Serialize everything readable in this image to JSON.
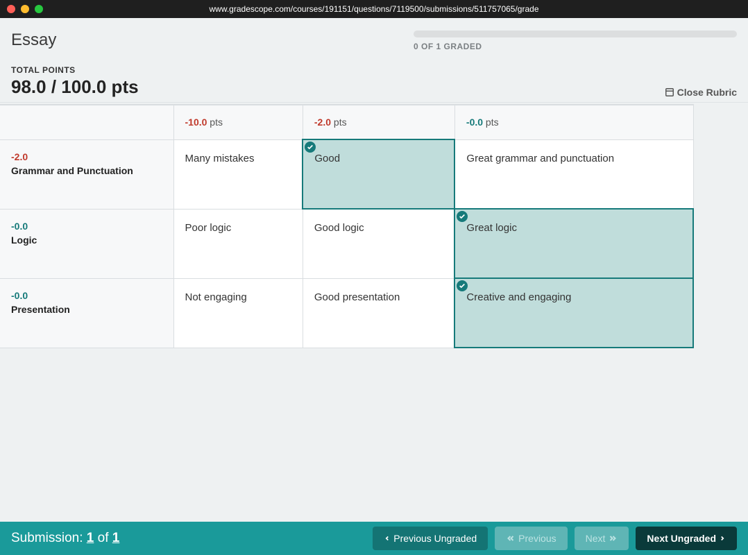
{
  "window": {
    "url": "www.gradescope.com/courses/191151/questions/7119500/submissions/511757065/grade"
  },
  "header": {
    "title": "Essay",
    "progress_text": "0 OF 1 GRADED"
  },
  "points": {
    "label": "TOTAL POINTS",
    "value": "98.0 / 100.0 pts",
    "close_rubric": "Close Rubric"
  },
  "rubric": {
    "col_pts": [
      "-10.0",
      "-2.0",
      "-0.0"
    ],
    "pts_unit": " pts",
    "rows": [
      {
        "points": "-2.0",
        "name": "Grammar and Punctuation",
        "cells": [
          "Many mistakes",
          "Good",
          "Great grammar and punctuation"
        ],
        "selected": 1,
        "points_style": "neg"
      },
      {
        "points": "-0.0",
        "name": "Logic",
        "cells": [
          "Poor logic",
          "Good logic",
          "Great logic"
        ],
        "selected": 2,
        "points_style": "zero"
      },
      {
        "points": "-0.0",
        "name": "Presentation",
        "cells": [
          "Not engaging",
          "Good presentation",
          "Creative and engaging"
        ],
        "selected": 2,
        "points_style": "zero"
      }
    ]
  },
  "footer": {
    "submission_prefix": "Submission: ",
    "current": "1",
    "of": " of ",
    "total": "1",
    "prev_ungraded": "Previous Ungraded",
    "previous": "Previous",
    "next": "Next",
    "next_ungraded": "Next Ungraded"
  }
}
